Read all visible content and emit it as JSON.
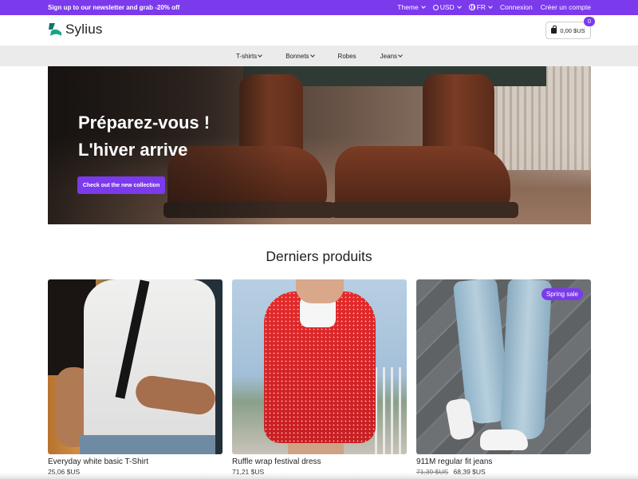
{
  "topbar": {
    "promo": "Sign up to our newsletter and grab -20% off",
    "theme": "Theme",
    "currency": "USD",
    "language": "FR",
    "login": "Connexion",
    "register": "Créer un compte"
  },
  "header": {
    "logo_text": "Sylius",
    "cart_total": "0,00 $US",
    "cart_count": "0"
  },
  "nav": {
    "items": [
      {
        "label": "T-shirts",
        "has_dropdown": true
      },
      {
        "label": "Bonnets",
        "has_dropdown": true
      },
      {
        "label": "Robes",
        "has_dropdown": false
      },
      {
        "label": "Jeans",
        "has_dropdown": true
      }
    ]
  },
  "hero": {
    "line1": "Préparez-vous !",
    "line2": "L'hiver arrive",
    "cta": "Check out the new collection"
  },
  "latest": {
    "title": "Derniers produits",
    "products": [
      {
        "name": "Everyday white basic T-Shirt",
        "price": "25,06 $US",
        "old_price": "",
        "badge": ""
      },
      {
        "name": "Ruffle wrap festival dress",
        "price": "71,21 $US",
        "old_price": "",
        "badge": ""
      },
      {
        "name": "911M regular fit jeans",
        "price": "68,39 $US",
        "old_price": "71,39 $US",
        "badge": "Spring sale"
      }
    ]
  },
  "colors": {
    "accent": "#7c3aed",
    "nav_bg": "#ebebeb",
    "logo_green": "#17a589"
  }
}
